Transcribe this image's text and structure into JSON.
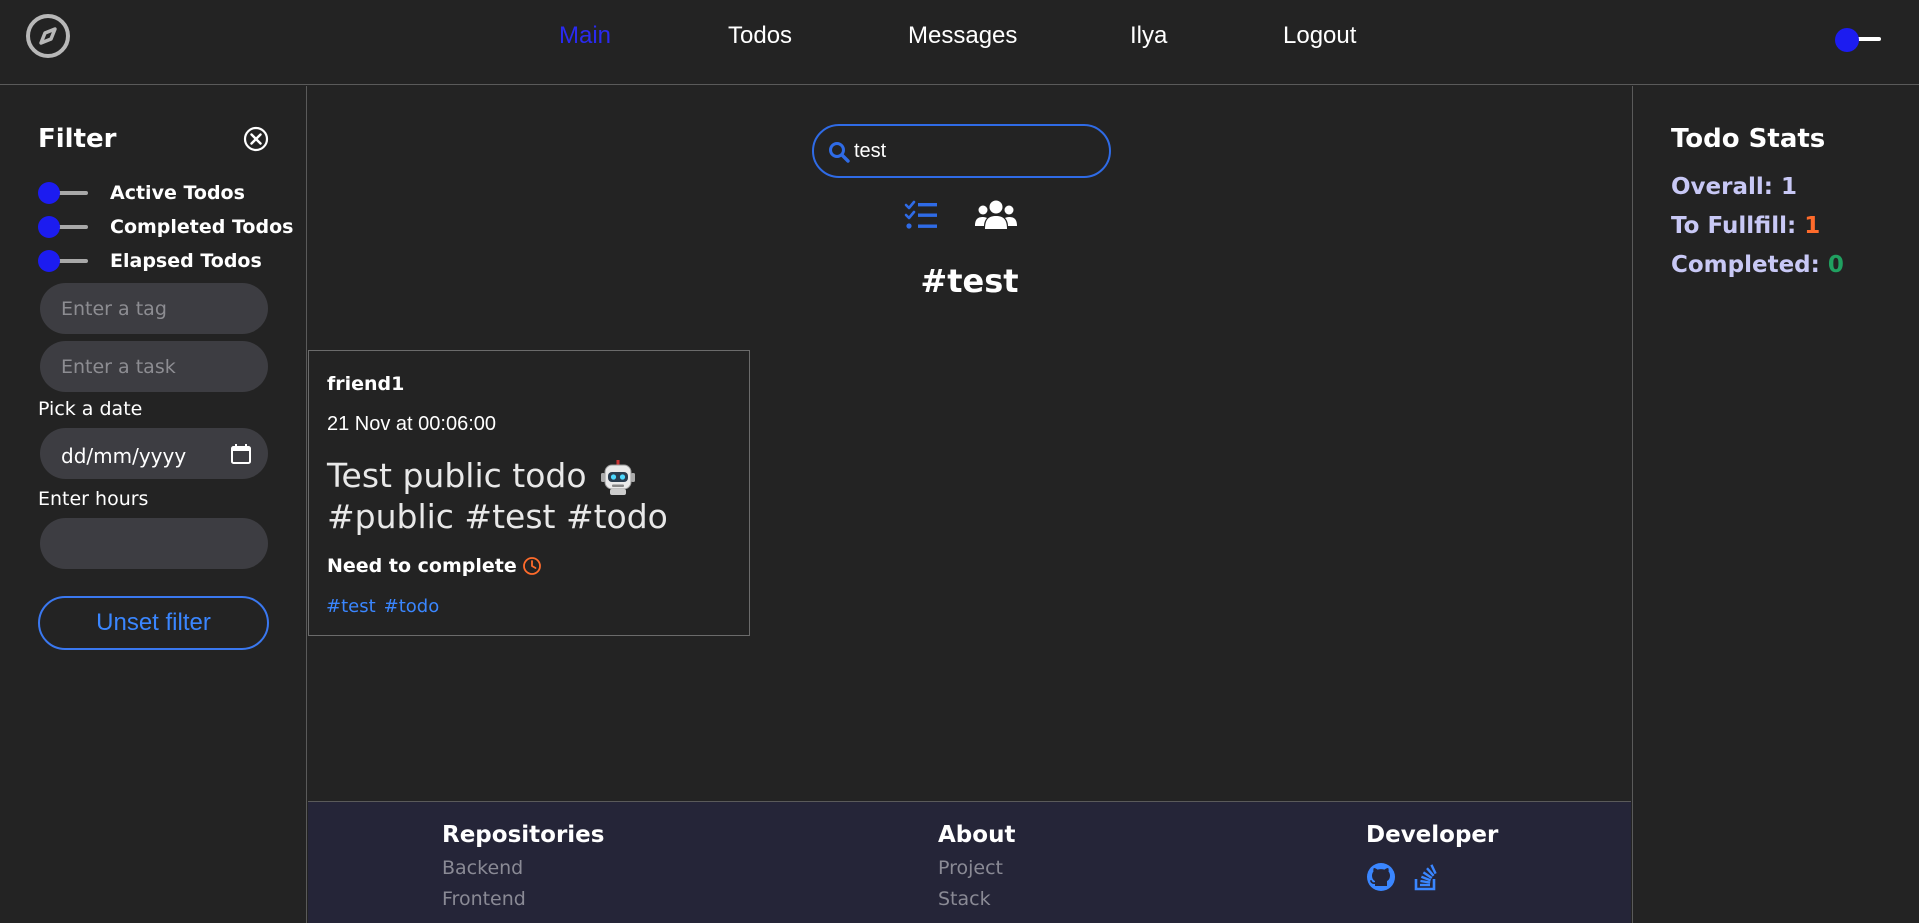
{
  "nav": {
    "logo_icon": "compass-icon",
    "items": [
      {
        "label": "Main",
        "active": true
      },
      {
        "label": "Todos",
        "active": false
      },
      {
        "label": "Messages",
        "active": false
      },
      {
        "label": "Ilya",
        "active": false
      },
      {
        "label": "Logout",
        "active": false
      }
    ],
    "accent_color": "#2a2af0"
  },
  "filter": {
    "title": "Filter",
    "switches": [
      {
        "label": "Active Todos"
      },
      {
        "label": "Completed Todos"
      },
      {
        "label": "Elapsed Todos"
      }
    ],
    "tag_placeholder": "Enter a tag",
    "task_placeholder": "Enter a task",
    "date_label": "Pick a date",
    "date_placeholder": "dd/mm/yyyy",
    "hours_label": "Enter hours",
    "hours_value": "",
    "unset_label": "Unset filter"
  },
  "main": {
    "search_value": "test",
    "hashtag_title": "#test",
    "card": {
      "user": "friend1",
      "date": "21 Nov at 00:06:00",
      "text_line1": "Test public todo",
      "text_line2": "#public #test #todo",
      "status": "Need to complete",
      "tags": [
        "#test",
        "#todo"
      ]
    }
  },
  "stats": {
    "title": "Todo Stats",
    "overall_label": "Overall:",
    "overall_value": "1",
    "tofulfill_label": "To Fullfill:",
    "tofulfill_value": "1",
    "completed_label": "Completed:",
    "completed_value": "0"
  },
  "footer": {
    "repositories": {
      "title": "Repositories",
      "links": [
        "Backend",
        "Frontend"
      ]
    },
    "about": {
      "title": "About",
      "links": [
        "Project",
        "Stack"
      ]
    },
    "developer": {
      "title": "Developer",
      "icons": [
        "github-icon",
        "stackoverflow-icon"
      ]
    }
  }
}
